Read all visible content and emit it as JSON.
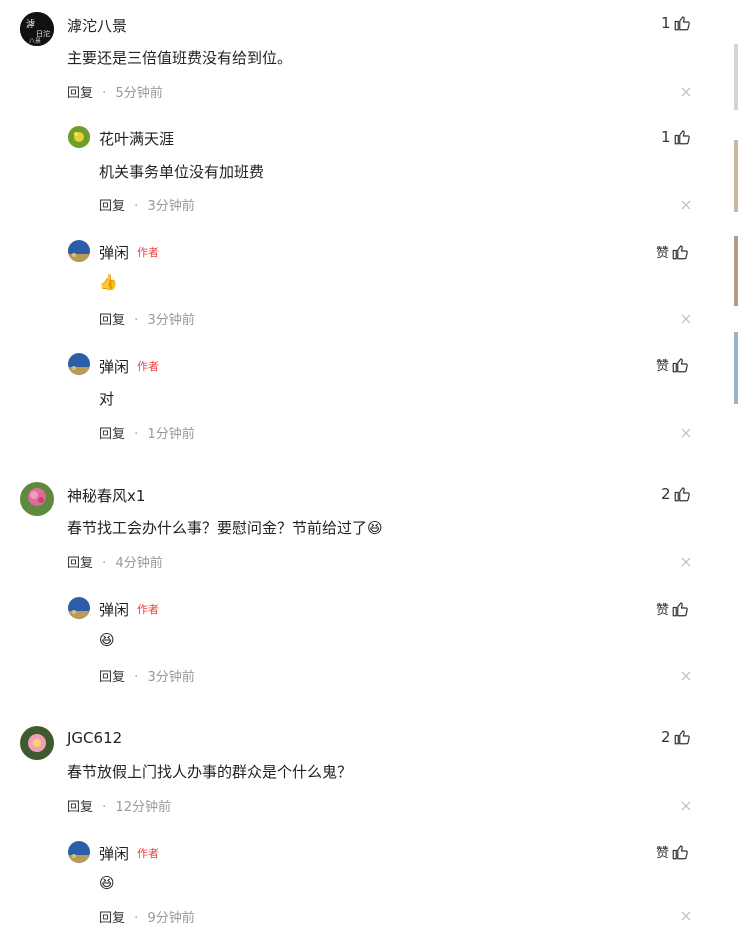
{
  "comments": [
    {
      "user": "滹沱八景",
      "text": "主要还是三倍值班费没有给到位。",
      "reply_label": "回复",
      "time": "5分钟前",
      "likes": "1",
      "replies": [
        {
          "user": "花叶满天涯",
          "text": "机关事务单位没有加班费",
          "reply_label": "回复",
          "time": "3分钟前",
          "likes": "1"
        },
        {
          "user": "弹闲",
          "badge": "作者",
          "text": "👍",
          "reply_label": "回复",
          "time": "3分钟前",
          "likes": "赞"
        },
        {
          "user": "弹闲",
          "badge": "作者",
          "text": "对",
          "reply_label": "回复",
          "time": "1分钟前",
          "likes": "赞"
        }
      ]
    },
    {
      "user": "神秘春风x1",
      "text": "春节找工会办什么事？要慰问金？节前给过了",
      "reply_label": "回复",
      "time": "4分钟前",
      "likes": "2",
      "replies": [
        {
          "user": "弹闲",
          "badge": "作者",
          "text": "😆",
          "reply_label": "回复",
          "time": "3分钟前",
          "likes": "赞"
        }
      ]
    },
    {
      "user": "JGC612",
      "text": "春节放假上门找人办事的群众是个什么鬼？",
      "reply_label": "回复",
      "time": "12分钟前",
      "likes": "2",
      "replies": [
        {
          "user": "弹闲",
          "badge": "作者",
          "text": "😆",
          "reply_label": "回复",
          "time": "9分钟前",
          "likes": "赞"
        }
      ]
    }
  ],
  "separator": "·",
  "colors": {
    "author_badge": "#f04142",
    "meta_time": "#999999",
    "text": "#222222"
  }
}
